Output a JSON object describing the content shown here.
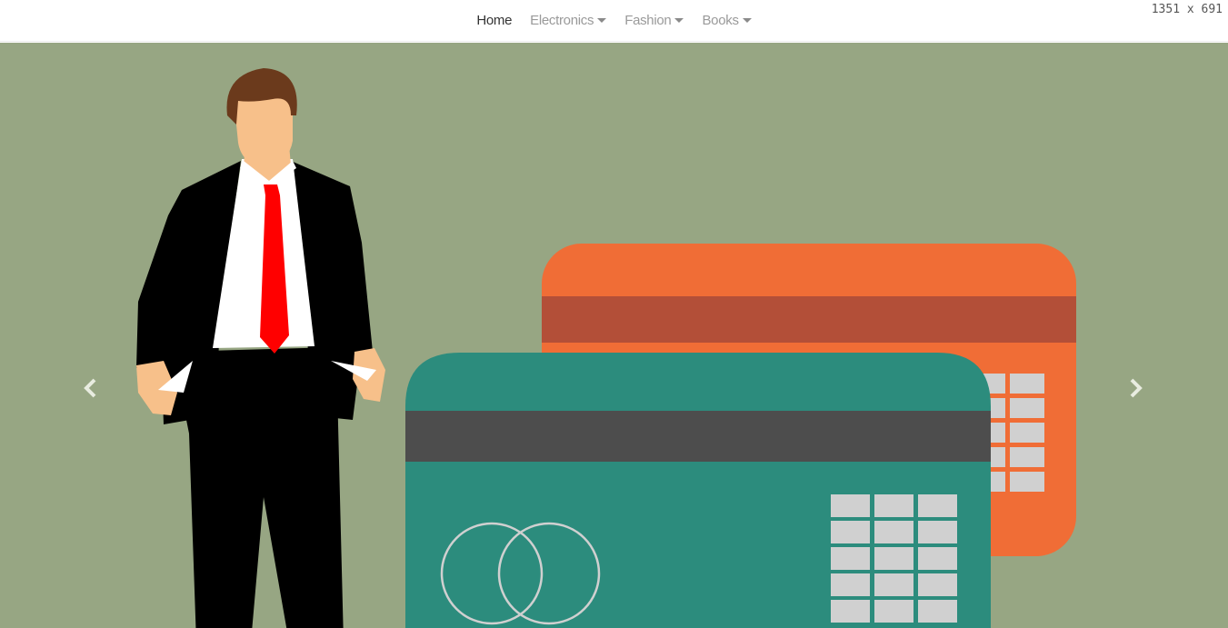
{
  "nav": {
    "items": [
      {
        "label": "Home",
        "active": true,
        "dropdown": false
      },
      {
        "label": "Electronics",
        "active": false,
        "dropdown": true
      },
      {
        "label": "Fashion",
        "active": false,
        "dropdown": true
      },
      {
        "label": "Books",
        "active": false,
        "dropdown": true
      }
    ]
  },
  "viewport_label": "1351 x 691",
  "carousel": {
    "prev_icon": "chevron-left-icon",
    "next_icon": "chevron-right-icon",
    "slide": "businessman-empty-pockets-credit-cards-illustration",
    "colors": {
      "background": "#97a683",
      "front_card": "#2c8c7d",
      "back_card": "#f06d36",
      "stripe_dark": "#4d4d4d",
      "stripe_red": "#b34f38",
      "chip": "#d0d0d0"
    }
  }
}
